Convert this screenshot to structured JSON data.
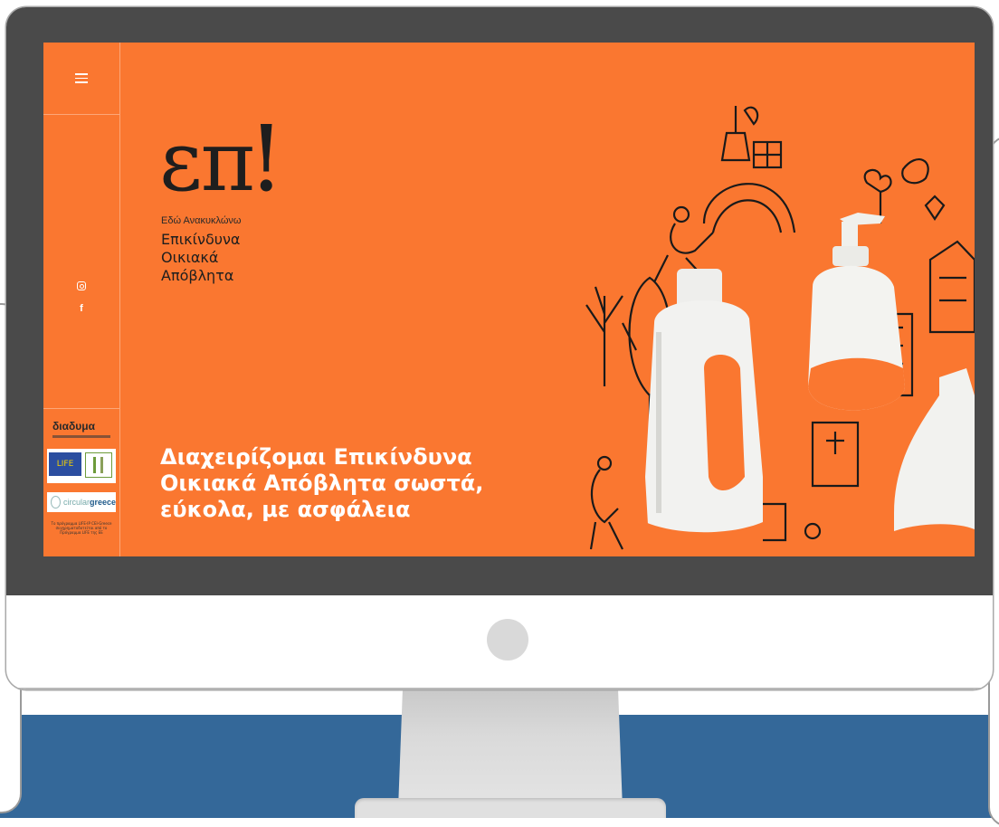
{
  "colors": {
    "screen_orange": "#fa7730",
    "bezel": "#4a4a4a",
    "background_blue": "#346899",
    "logo_dark": "#1e1e1e",
    "headline_white": "#ffffff"
  },
  "sidebar": {
    "menu_icon": "hamburger-menu-icon",
    "social": {
      "instagram_icon": "instagram-icon",
      "facebook_icon": "facebook-icon",
      "facebook_glyph": "f"
    },
    "sponsors": {
      "diadyma": "διαδυμα",
      "eu_life": "LIFE",
      "circular_prefix": "circular",
      "circular_brand": "greece",
      "note": "Το πρόγραμμα LIFE-IP CEI-Greece συγχρηματοδοτείται από το Πρόγραμμα LIFE της ΕΕ"
    }
  },
  "hero": {
    "logo_text": "επ",
    "logo_bang": "!",
    "tagline_small": "Εδώ Ανακυκλώνω",
    "tagline_lines": [
      "Επικίνδυνα",
      "Οικιακά",
      "Απόβλητα"
    ],
    "headline_lines": [
      "Διαχειρίζομαι Επικίνδυνα",
      "Οικιακά Απόβλητα σωστά,",
      "εύκολα, με ασφάλεια"
    ]
  }
}
